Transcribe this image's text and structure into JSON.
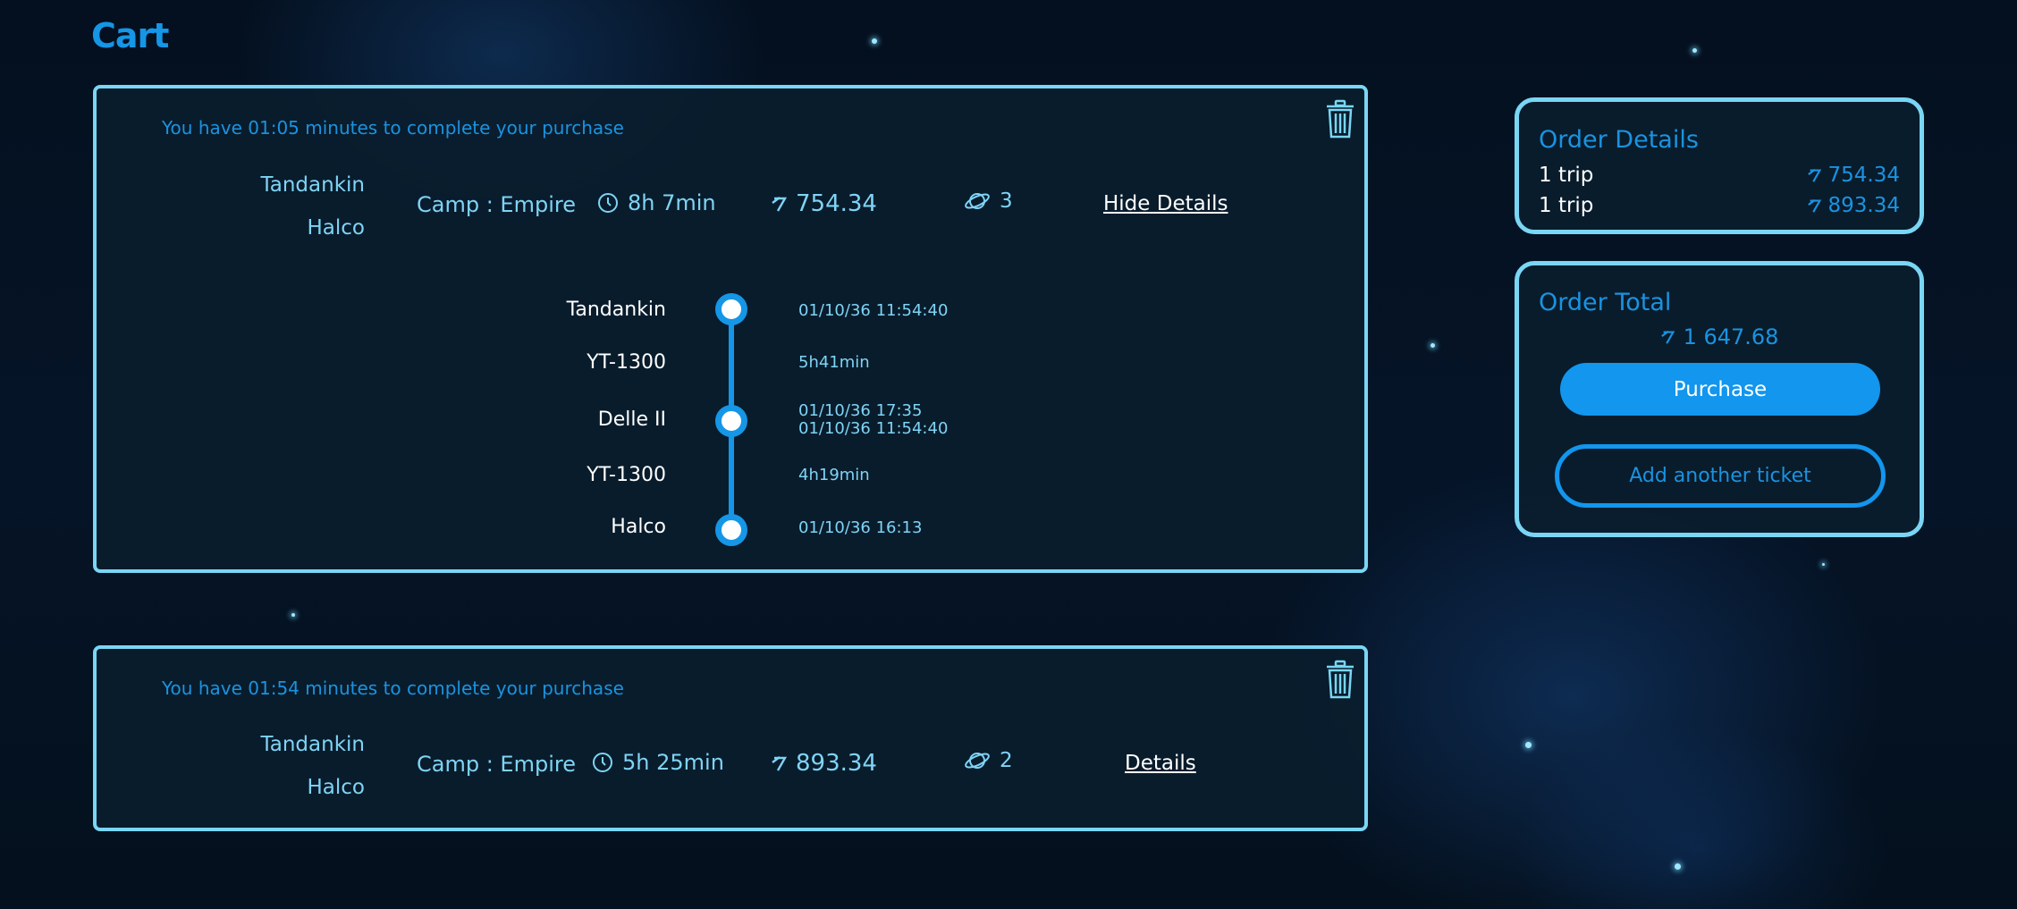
{
  "page": {
    "title": "Cart"
  },
  "colors": {
    "accent": "#1596e6",
    "border": "#79d6f4",
    "text": "#7fd4f5",
    "background": "#04101f"
  },
  "tickets": [
    {
      "timer_text": "You have 01:05 minutes to complete your purchase",
      "origin": "Tandankin",
      "destination": "Halco",
      "company": "Camp : Empire",
      "duration": "8h 7min",
      "price": "754.34",
      "stops": "3",
      "details_label": "Hide Details",
      "expanded": true,
      "timeline": {
        "points": [
          {
            "name": "Tandankin",
            "times": [
              "01/10/36 11:54:40"
            ]
          },
          {
            "name": "Delle II",
            "times": [
              "01/10/36 17:35",
              "01/10/36 11:54:40"
            ]
          },
          {
            "name": "Halco",
            "times": [
              "01/10/36 16:13"
            ]
          }
        ],
        "legs": [
          {
            "ship": "YT-1300",
            "duration": "5h41min"
          },
          {
            "ship": "YT-1300",
            "duration": "4h19min"
          }
        ]
      }
    },
    {
      "timer_text": "You have 01:54 minutes to complete your purchase",
      "origin": "Tandankin",
      "destination": "Halco",
      "company": "Camp : Empire",
      "duration": "5h 25min",
      "price": "893.34",
      "stops": "2",
      "details_label": "Details",
      "expanded": false
    }
  ],
  "order_details": {
    "title": "Order Details",
    "rows": [
      {
        "label": "1 trip",
        "price": "754.34"
      },
      {
        "label": "1 trip",
        "price": "893.34"
      }
    ]
  },
  "order_total": {
    "title": "Order Total",
    "amount": "1 647.68",
    "purchase_label": "Purchase",
    "add_label": "Add another ticket"
  },
  "icons": {
    "currency": "currency-icon",
    "clock": "clock-icon",
    "planet": "planet-icon",
    "trash": "trash-icon"
  }
}
